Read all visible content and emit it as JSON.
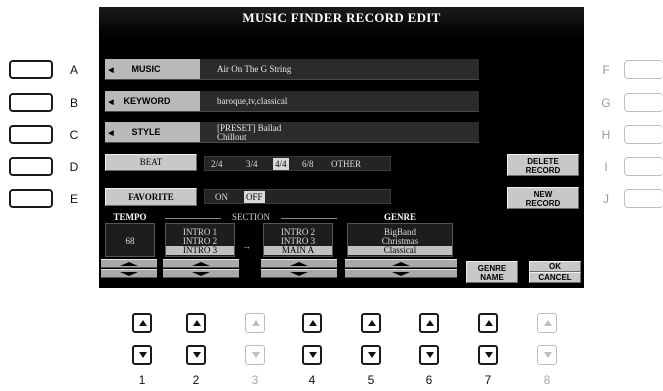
{
  "screen": {
    "title": "MUSIC FINDER RECORD EDIT",
    "music": {
      "label": "MUSIC",
      "value": "Air On The G String"
    },
    "keyword": {
      "label": "KEYWORD",
      "value": "baroque,tv,classical"
    },
    "style": {
      "label": "STYLE",
      "value_line1": "[PRESET]   Ballad",
      "value_line2": "Chillout"
    },
    "beat": {
      "label": "BEAT",
      "options": [
        "2/4",
        "3/4",
        "4/4",
        "6/8",
        "OTHER"
      ],
      "selected": "4/4"
    },
    "favorite": {
      "label": "FAVORITE",
      "options": [
        "ON",
        "OFF"
      ],
      "selected": "OFF"
    },
    "delete_record": {
      "line1": "DELETE",
      "line2": "RECORD"
    },
    "new_record": {
      "line1": "NEW",
      "line2": "RECORD"
    },
    "tempo": {
      "header": "TEMPO",
      "value": "68"
    },
    "section": {
      "header": "SECTION",
      "from": [
        "INTRO 1",
        "INTRO 2",
        "INTRO 3"
      ],
      "from_selected": "INTRO 3",
      "arrow": "→",
      "to": [
        "INTRO 2",
        "INTRO 3",
        "MAIN A"
      ],
      "to_selected": "MAIN A"
    },
    "genre": {
      "header": "GENRE",
      "items": [
        "BigBand",
        "Christmas",
        "Classical"
      ],
      "selected": "Classical"
    },
    "genre_name": {
      "line1": "GENRE",
      "line2": "NAME"
    },
    "ok_cancel": {
      "ok": "OK",
      "cancel": "CANCEL"
    }
  },
  "side_buttons": {
    "left": [
      "A",
      "B",
      "C",
      "D",
      "E"
    ],
    "right": [
      "F",
      "G",
      "H",
      "I",
      "J"
    ]
  },
  "bottom_buttons": {
    "numbers": [
      "1",
      "2",
      "3",
      "4",
      "5",
      "6",
      "7",
      "8"
    ],
    "disabled": [
      "3",
      "8"
    ]
  }
}
